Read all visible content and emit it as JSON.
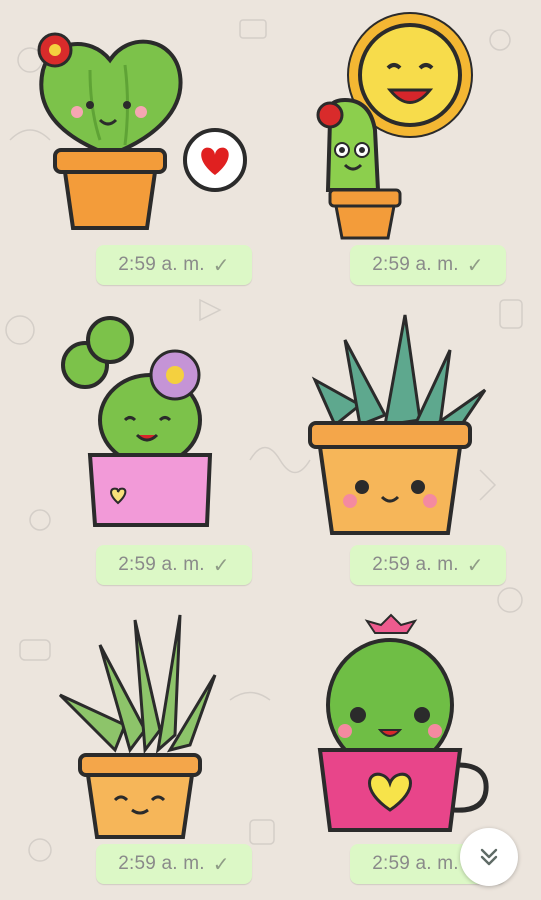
{
  "messages": [
    {
      "sticker": "cactus-heart-sticker",
      "time": "2:59 a. m.",
      "status_icon": "check-icon"
    },
    {
      "sticker": "cactus-sun-sticker",
      "time": "2:59 a. m.",
      "status_icon": "check-icon"
    },
    {
      "sticker": "cactus-flower-pink-pot-sticker",
      "time": "2:59 a. m.",
      "status_icon": "check-icon"
    },
    {
      "sticker": "striped-succulent-sticker",
      "time": "2:59 a. m.",
      "status_icon": "check-icon"
    },
    {
      "sticker": "aloe-plant-sticker",
      "time": "2:59 a. m.",
      "status_icon": "check-icon"
    },
    {
      "sticker": "cactus-teacup-sticker",
      "time": "2:59 a. m.",
      "status_icon": "check-icon"
    }
  ],
  "tick_glyph": "✓",
  "scroll_button": {
    "icon": "double-chevron-down-icon"
  },
  "colors": {
    "background": "#ece5dd",
    "bubble": "#dcf8c6",
    "time_text": "#8a8a8a"
  }
}
